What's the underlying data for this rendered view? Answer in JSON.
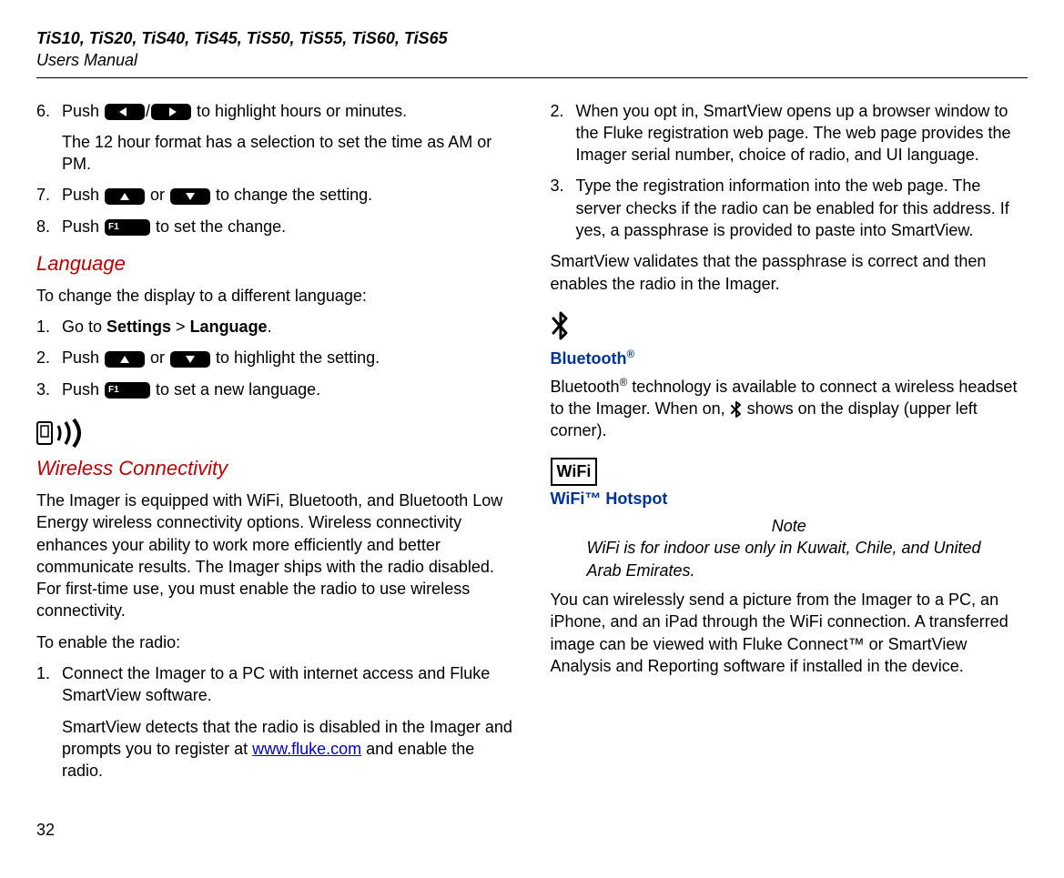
{
  "header": {
    "product": "TiS10, TiS20, TiS40, TiS45, TiS50, TiS55, TiS60, TiS65",
    "sub": "Users Manual"
  },
  "left": {
    "step6_num": "6.",
    "step6_a": "Push ",
    "step6_b": "/",
    "step6_c": " to highlight hours or minutes.",
    "step6_note": "The 12 hour format has a selection to set the time as AM or PM.",
    "step7_num": "7.",
    "step7_a": "Push ",
    "step7_b": " or ",
    "step7_c": " to change the setting.",
    "step8_num": "8.",
    "step8_a": "Push ",
    "step8_b": " to set the change.",
    "lang_head": "Language",
    "lang_intro": "To change the display to a different language:",
    "lang1_num": "1.",
    "lang1_a": "Go to ",
    "lang1_b": "Settings",
    "lang1_c": " > ",
    "lang1_d": "Language",
    "lang1_e": ".",
    "lang2_num": "2.",
    "lang2_a": "Push ",
    "lang2_b": " or ",
    "lang2_c": " to highlight the setting.",
    "lang3_num": "3.",
    "lang3_a": "Push ",
    "lang3_b": " to set a new language.",
    "wireless_head": "Wireless Connectivity",
    "wireless_para": "The Imager is equipped with WiFi, Bluetooth, and Bluetooth Low Energy wireless connectivity options. Wireless connectivity enhances your ability to work more efficiently and better communicate results. The Imager ships with the radio disabled. For first-time use, you must enable the radio to use wireless connectivity.",
    "enable_intro": "To enable the radio:",
    "en1_num": "1.",
    "en1_text": "Connect the Imager to a PC with internet access and Fluke SmartView software.",
    "en1_note_a": "SmartView detects that the radio is disabled in the Imager and prompts you to register at ",
    "en1_note_link": "www.fluke.com",
    "en1_note_b": " and enable the radio."
  },
  "right": {
    "en2_num": "2.",
    "en2_text": "When you opt in, SmartView opens up a browser window to the Fluke registration web page. The web page provides the Imager serial number, choice of radio, and UI language.",
    "en3_num": "3.",
    "en3_text": "Type the registration information into the web page. The server checks if the radio can be enabled for this address. If yes, a passphrase is provided to paste into SmartView.",
    "sv_para": "SmartView validates that the passphrase is correct and then enables the radio in the Imager.",
    "bt_head_a": "Bluetooth",
    "bt_head_b": "®",
    "bt_para_a": "Bluetooth",
    "bt_para_b": "®",
    "bt_para_c": " technology is available to connect a wireless headset to the Imager. When on, ",
    "bt_para_d": " shows on the display (upper left corner).",
    "wifi_box": "WiFi",
    "wifi_head": "WiFi™ Hotspot",
    "note_title": "Note",
    "note_body": "WiFi is for indoor use only in Kuwait, Chile, and United Arab Emirates.",
    "wifi_para": "You can wirelessly send a picture from the Imager to a PC, an iPhone, and an iPad through the WiFi connection. A transferred image can be viewed with Fluke Connect™ or SmartView Analysis and Reporting software if installed in the device."
  },
  "page": "32"
}
